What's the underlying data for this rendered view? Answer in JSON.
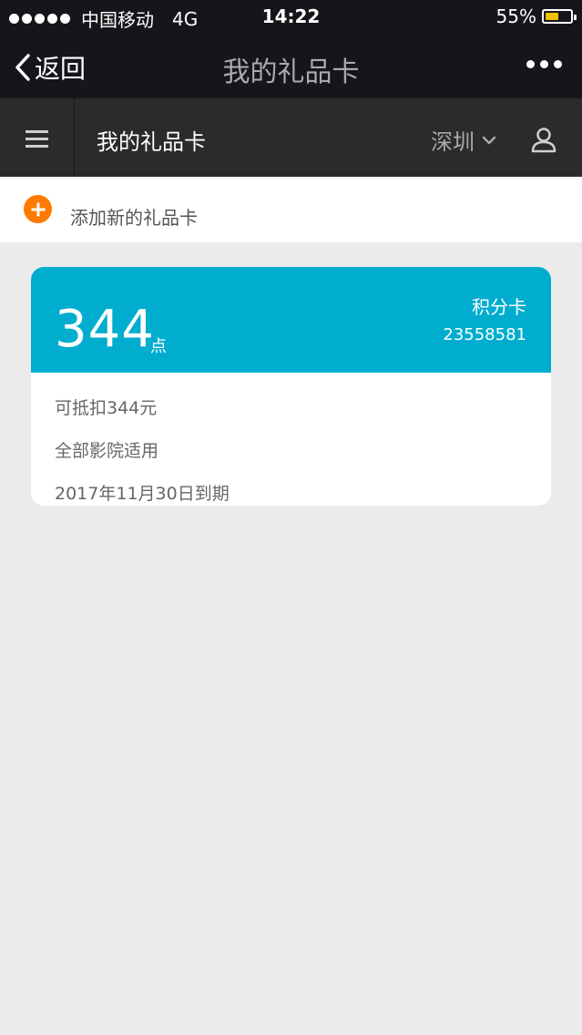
{
  "status": {
    "carrier": "中国移动",
    "network": "4G",
    "time": "14:22",
    "battery": "55%",
    "battery_level": 0.55
  },
  "nav": {
    "back_label": "返回",
    "title": "我的礼品卡"
  },
  "appbar": {
    "title": "我的礼品卡",
    "city": "深圳"
  },
  "add_card": {
    "label": "添加新的礼品卡"
  },
  "card": {
    "points": "344",
    "points_unit": "点",
    "type": "积分卡",
    "number": "23558581",
    "details": [
      "可抵扣344元",
      "全部影院适用",
      "2017年11月30日到期"
    ]
  },
  "colors": {
    "header_bg": "#15161a",
    "appbar_bg": "#2b2b2b",
    "card_header": "#00adcf",
    "accent_orange": "#ff7a00",
    "page_bg": "#ebebeb"
  }
}
